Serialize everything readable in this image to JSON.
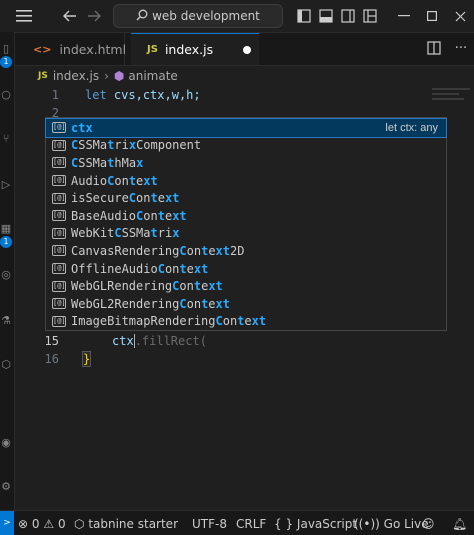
{
  "titlebar": {
    "search_text": "web development",
    "icons": [
      "menu-icon",
      "back-arrow-icon",
      "forward-arrow-icon",
      "search-icon",
      "toggle-primary-sidebar-icon",
      "toggle-panel-icon",
      "toggle-secondary-sidebar-icon",
      "customize-layout-icon",
      "minimize-icon"
    ]
  },
  "activity": {
    "badges": [
      "1",
      "1"
    ]
  },
  "tabs": [
    {
      "label": "index.html",
      "icon": "html-file-icon"
    },
    {
      "label": "index.js",
      "icon": "js-file-icon",
      "icon_text": "JS",
      "modified": true
    }
  ],
  "breadcrumb": {
    "file_icon_text": "JS",
    "file": "index.js",
    "symbol": "animate"
  },
  "editor": {
    "lines": [
      {
        "num": "1",
        "code_kw": "let",
        "code_rest": "cvs,ctx,w,h;"
      },
      {
        "num": "2",
        "code": ""
      },
      {
        "num": "15",
        "code_ident": "ctx",
        "code_ghost": ".fillRect("
      },
      {
        "num": "16",
        "code_brace": "}"
      }
    ]
  },
  "suggest": {
    "icon_text": "[@]",
    "items": [
      {
        "pre": "",
        "hl": "ctx",
        "post": "",
        "detail": "let ctx: any"
      },
      {
        "pre": "",
        "hl": "C",
        "mid": "SSMa",
        "hl2": "t",
        "mid2": "ri",
        "hl3": "x",
        "post": "Component"
      },
      {
        "pre": "",
        "hl": "C",
        "mid": "SSMa",
        "hl2": "t",
        "mid2": "hMa",
        "hl3": "x",
        "post": ""
      },
      {
        "pre": "Audio",
        "hl": "C",
        "mid": "on",
        "hl2": "t",
        "mid2": "e",
        "hl3": "xt",
        "post": ""
      },
      {
        "pre": "isSecure",
        "hl": "C",
        "mid": "on",
        "hl2": "t",
        "mid2": "e",
        "hl3": "xt",
        "post": ""
      },
      {
        "pre": "BaseAudio",
        "hl": "C",
        "mid": "on",
        "hl2": "t",
        "mid2": "e",
        "hl3": "xt",
        "post": ""
      },
      {
        "pre": "WebKit",
        "hl": "C",
        "mid": "SSMa",
        "hl2": "t",
        "mid2": "ri",
        "hl3": "x",
        "post": ""
      },
      {
        "pre": "Canvas",
        "hl": "",
        "mid": "Rendering",
        "hl2": "C",
        "mid2": "on",
        "hl3": "t",
        "post": "e",
        "hl4": "xt",
        "post2": "2D"
      },
      {
        "pre": "OfflineAudio",
        "hl": "C",
        "mid": "on",
        "hl2": "t",
        "mid2": "e",
        "hl3": "xt",
        "post": ""
      },
      {
        "pre": "WebGLRendering",
        "hl": "C",
        "mid": "on",
        "hl2": "t",
        "mid2": "e",
        "hl3": "xt",
        "post": ""
      },
      {
        "pre": "WebGL2Rendering",
        "hl": "C",
        "mid": "on",
        "hl2": "t",
        "mid2": "e",
        "hl3": "xt",
        "post": ""
      },
      {
        "pre": "ImageBitmapRendering",
        "hl": "C",
        "mid": "on",
        "hl2": "t",
        "mid2": "e",
        "hl3": "xt",
        "post": ""
      }
    ]
  },
  "statusbar": {
    "errors": "0",
    "warnings": "0",
    "tabnine": "tabnine starter",
    "encoding": "UTF-8",
    "eol": "CRLF",
    "language": "JavaScript",
    "go_live": "Go Live"
  },
  "colors": {
    "accent": "#0078d4",
    "suggest_highlight": "#2aaaff",
    "keyword": "#569cd6",
    "identifier": "#9cdcfe"
  }
}
